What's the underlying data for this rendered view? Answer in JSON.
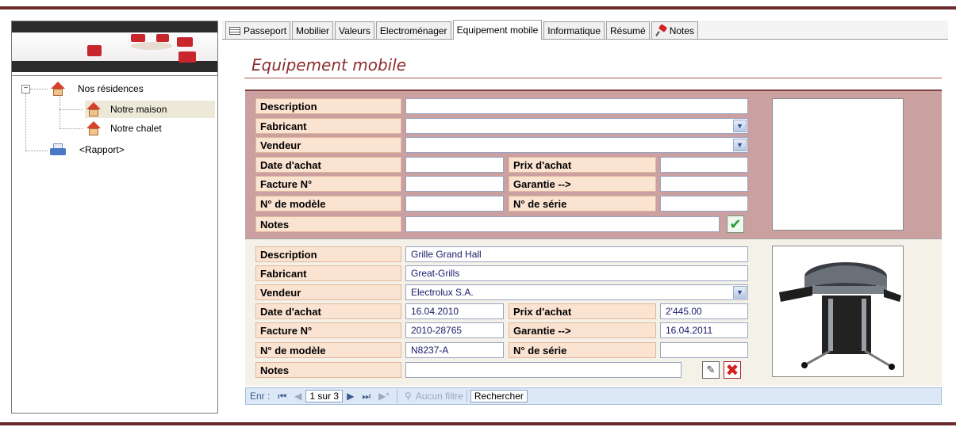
{
  "colors": {
    "accent": "#8b2e2e",
    "top_panel": "#caa0a0",
    "label_bg": "#fbe3d2",
    "nav_bg": "#dce8f6"
  },
  "sidebar": {
    "tree": {
      "root": {
        "label": "Nos résidences",
        "icon": "house-icon"
      },
      "children": [
        {
          "label": "Notre maison",
          "icon": "house-icon",
          "selected": true
        },
        {
          "label": "Notre chalet",
          "icon": "house-icon",
          "selected": false
        }
      ],
      "report": {
        "label": "<Rapport>",
        "icon": "printer-icon"
      }
    }
  },
  "tabs": [
    {
      "label": "Passeport",
      "icon": "sheet-icon",
      "active": false
    },
    {
      "label": "Mobilier",
      "active": false
    },
    {
      "label": "Valeurs",
      "active": false
    },
    {
      "label": "Electroménager",
      "active": false
    },
    {
      "label": "Equipement mobile",
      "active": true
    },
    {
      "label": "Informatique",
      "active": false
    },
    {
      "label": "Résumé",
      "active": false
    },
    {
      "label": "Notes",
      "icon": "pin-icon",
      "active": false
    }
  ],
  "page": {
    "title": "Equipement mobile"
  },
  "labels": {
    "description": "Description",
    "fabricant": "Fabricant",
    "vendeur": "Vendeur",
    "date_achat": "Date d'achat",
    "prix_achat": "Prix d'achat",
    "facture": "Facture N°",
    "garantie": "Garantie -->",
    "modele": "N° de modèle",
    "serie": "N° de série",
    "notes": "Notes"
  },
  "new_record": {
    "description": "",
    "fabricant": "",
    "vendeur": "",
    "date_achat": "",
    "prix_achat": "",
    "facture": "",
    "garantie": "",
    "modele": "",
    "serie": "",
    "notes": ""
  },
  "record": {
    "description": "Grille Grand Hall",
    "fabricant": "Great-Grills",
    "vendeur": "Electrolux S.A.",
    "date_achat": "16.04.2010",
    "prix_achat": "2'445.00",
    "facture": "2010-28765",
    "garantie": "16.04.2011",
    "modele": "N8237-A",
    "serie": "",
    "notes": ""
  },
  "navigation": {
    "record_label": "Enr :",
    "position": "1 sur 3",
    "filter": "Aucun filtre",
    "search": "Rechercher"
  }
}
